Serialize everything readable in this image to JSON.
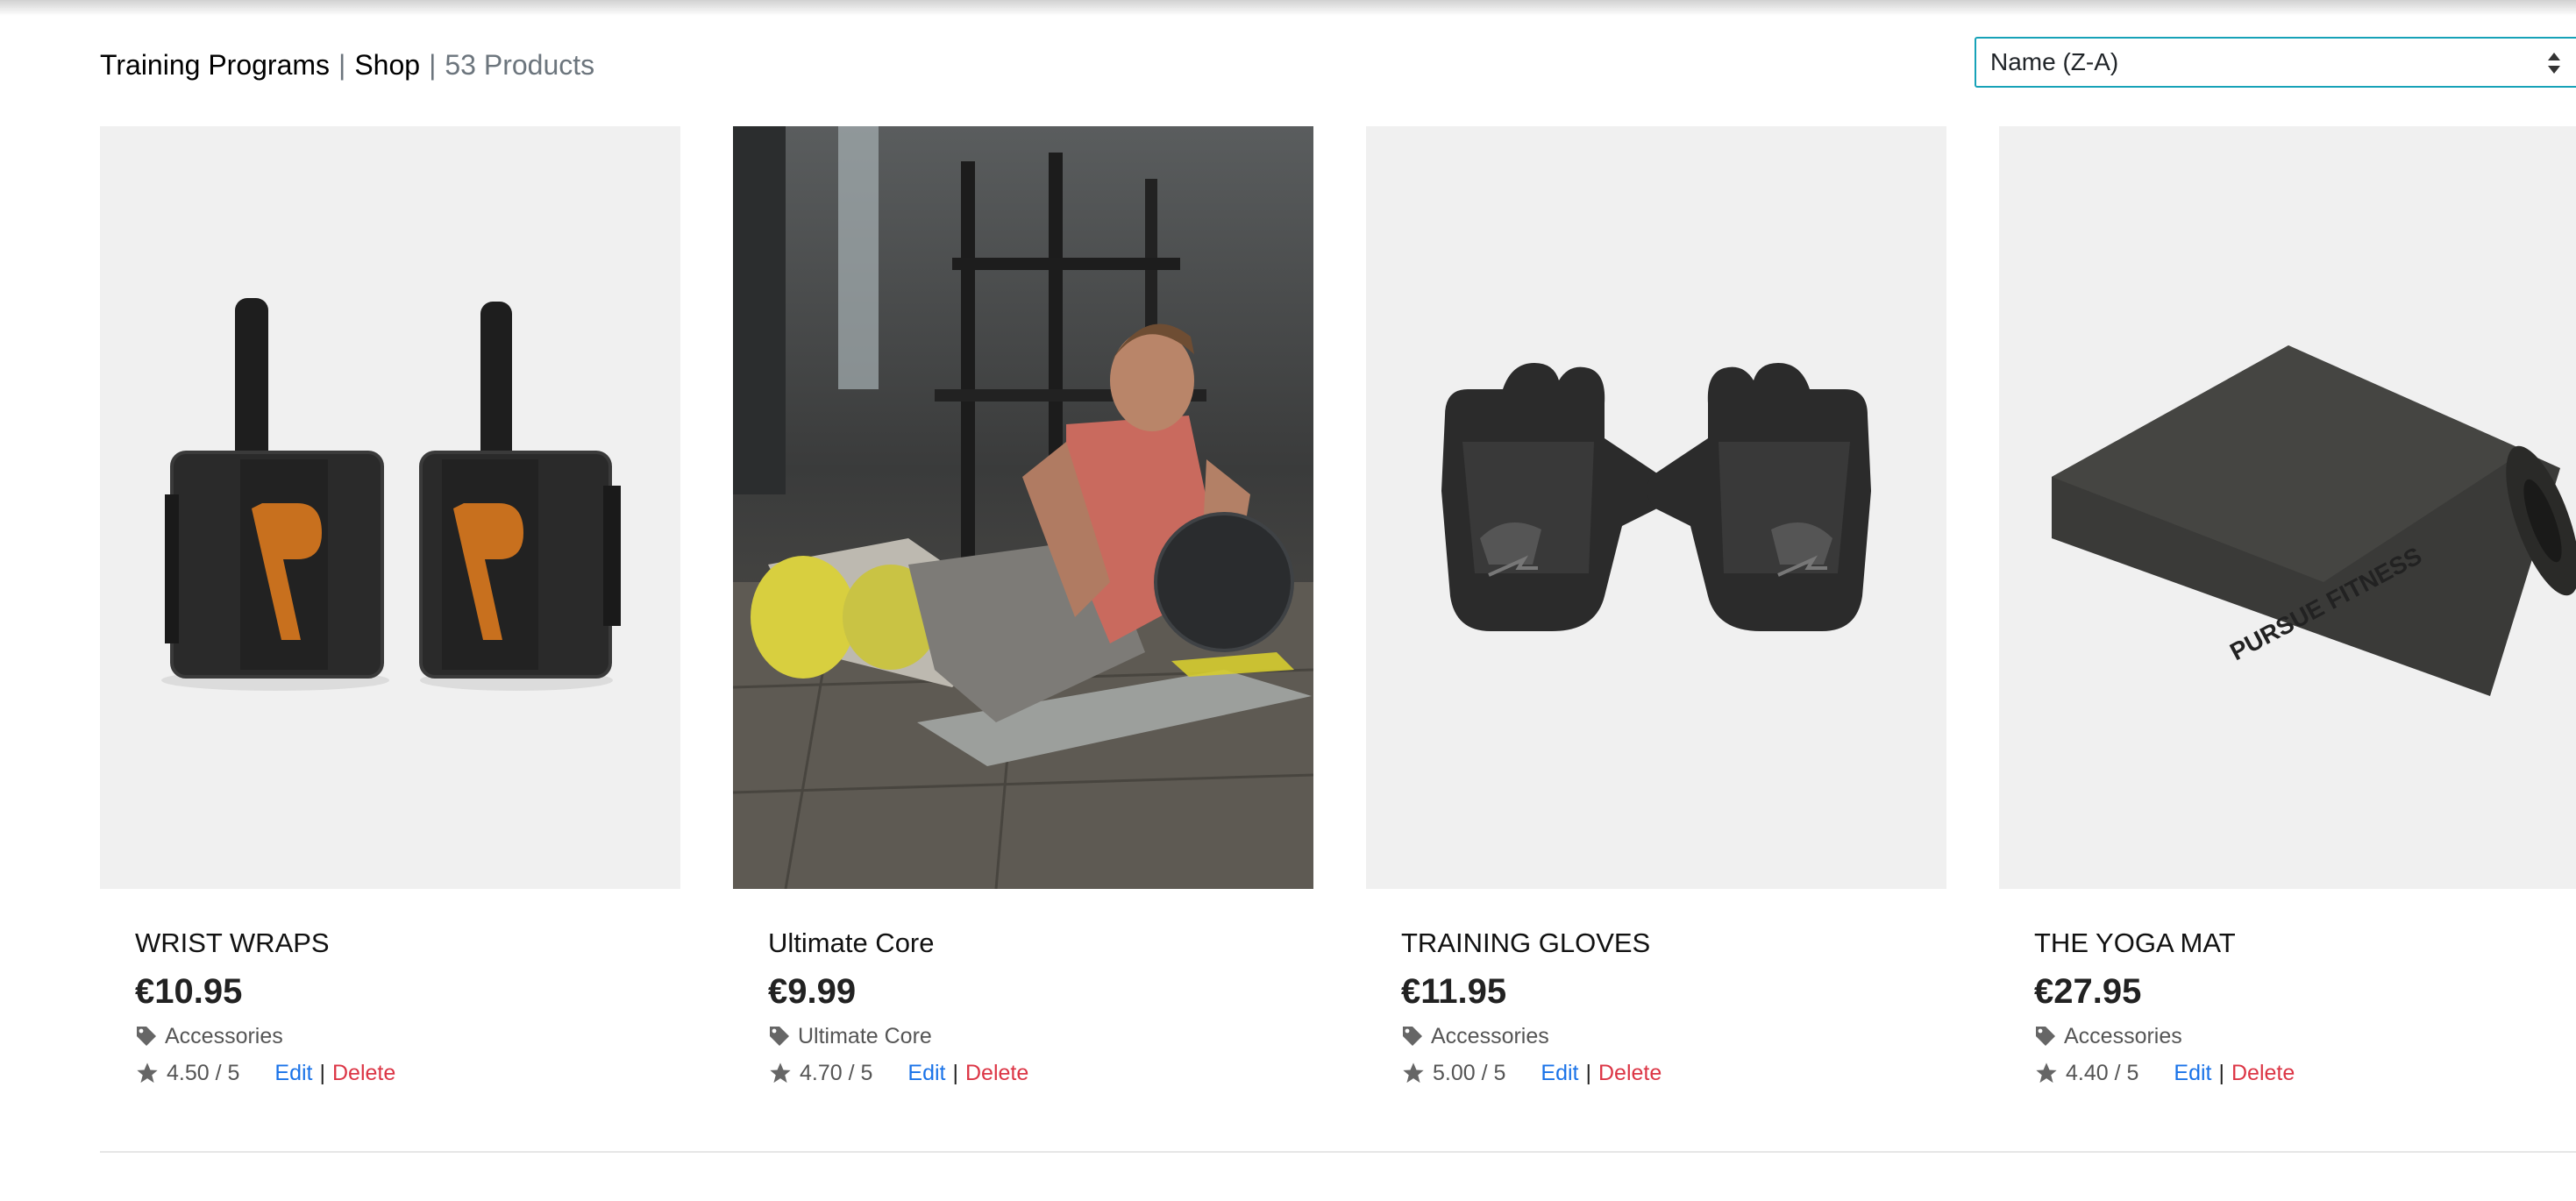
{
  "header": {
    "breadcrumb_training": "Training Programs",
    "breadcrumb_sep1": "|",
    "breadcrumb_shop": "Shop",
    "breadcrumb_sep2": "|",
    "product_count": "53 Products"
  },
  "sort": {
    "selected": "Name (Z-A)"
  },
  "products": [
    {
      "title": "WRIST WRAPS",
      "price": "€10.95",
      "category": "Accessories",
      "rating": "4.50 / 5",
      "edit": "Edit",
      "sep": "|",
      "delete": "Delete",
      "image": "wrist-wraps"
    },
    {
      "title": "Ultimate Core",
      "price": "€9.99",
      "category": "Ultimate Core",
      "rating": "4.70 / 5",
      "edit": "Edit",
      "sep": "|",
      "delete": "Delete",
      "image": "man-with-medicine-ball"
    },
    {
      "title": "TRAINING GLOVES",
      "price": "€11.95",
      "category": "Accessories",
      "rating": "5.00 / 5",
      "edit": "Edit",
      "sep": "|",
      "delete": "Delete",
      "image": "training-gloves"
    },
    {
      "title": "THE YOGA MAT",
      "price": "€27.95",
      "category": "Accessories",
      "rating": "4.40 / 5",
      "edit": "Edit",
      "sep": "|",
      "delete": "Delete",
      "image": "yoga-mat",
      "image_text": "PURSUE FITNESS"
    }
  ],
  "icons": {
    "category": "tag-icon",
    "rating": "star-icon",
    "sort": "sort-arrows-icon"
  },
  "colors": {
    "edit_link": "#1a73e8",
    "delete_link": "#dc3545",
    "select_border": "#17a2b8",
    "muted_text": "#6c757d",
    "image_background": "#f0f0f0",
    "brand_orange": "#c8701e"
  }
}
